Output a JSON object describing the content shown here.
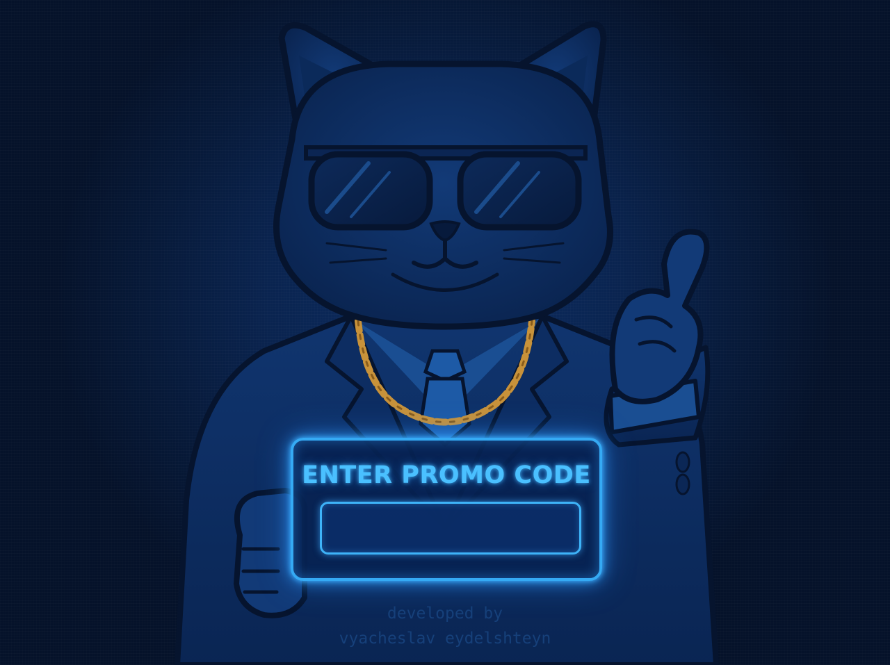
{
  "promo": {
    "title": "ENTER PROMO CODE",
    "input_value": "",
    "input_placeholder": ""
  },
  "credits": {
    "line1": "developed by",
    "line2": "vyacheslav eydelshteyn"
  },
  "mascot": {
    "icon": "cat-in-suit-with-sunglasses-icon",
    "accessories": [
      "sunglasses-icon",
      "gold-chain-icon",
      "necktie-icon",
      "thumbs-up-paw-icon"
    ]
  },
  "colors": {
    "background": "#0a2450",
    "neon_accent": "#35aaf4",
    "title_text": "#4ac0ff",
    "gold_chain": "#c8923a",
    "credit_text": "#16407a"
  }
}
